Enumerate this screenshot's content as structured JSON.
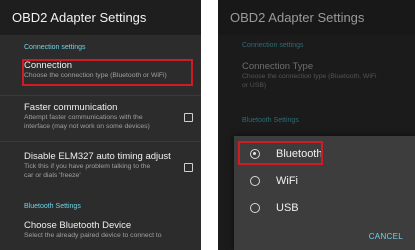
{
  "left": {
    "title": "OBD2 Adapter Settings",
    "section_connection": "Connection settings",
    "connection": {
      "title": "Connection",
      "summary": "Choose the connection type (Bluetooth or WiFi)"
    },
    "faster": {
      "title": "Faster communication",
      "summary_1": "Attempt faster communications with the",
      "summary_2": "interface (may not work on some devices)"
    },
    "disable": {
      "title": "Disable ELM327 auto timing adjust",
      "summary_1": "Tick this if you have problem talking to the",
      "summary_2": "car or dials 'freeze'"
    },
    "section_bluetooth": "Bluetooth Settings",
    "choose": {
      "title": "Choose Bluetooth Device",
      "summary": "Select the already paired device to connect to"
    }
  },
  "right": {
    "title": "OBD2 Adapter Settings",
    "section_connection": "Connection settings",
    "connection": {
      "title": "Connection Type",
      "summary_1": "Choose the connection type (Bluetooth, WiFi",
      "summary_2": "or USB)"
    },
    "section_bluetooth": "Bluetooth Settings",
    "dialog": {
      "options": [
        {
          "label": "Bluetooth",
          "selected": true
        },
        {
          "label": "WiFi",
          "selected": false
        },
        {
          "label": "USB",
          "selected": false
        }
      ],
      "cancel_label": "CANCEL"
    }
  },
  "colors": {
    "accent": "#6fd3e6",
    "highlight": "#d21a25"
  }
}
